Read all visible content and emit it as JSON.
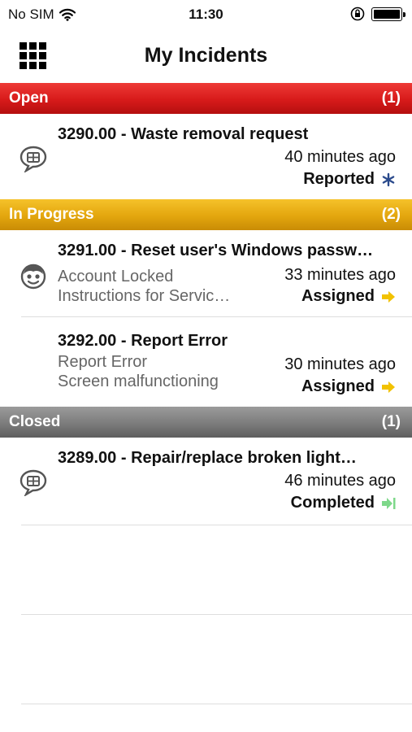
{
  "status_bar": {
    "carrier": "No SIM",
    "time": "11:30"
  },
  "nav": {
    "title": "My Incidents"
  },
  "sections": [
    {
      "label": "Open",
      "count": "(1)",
      "color": "#d71a1a",
      "items": [
        {
          "title": "3290.00 - Waste removal request",
          "line1": "",
          "line2": "",
          "time": "40 minutes ago",
          "status": "Reported",
          "icon": "speech-bubble-icon",
          "status_icon": "asterisk-icon"
        }
      ]
    },
    {
      "label": "In Progress",
      "count": "(2)",
      "color": "#e3a60e",
      "items": [
        {
          "title": "3291.00 - Reset user's Windows passw…",
          "line1": "Account Locked",
          "line2": "Instructions for Servic…",
          "time": "33 minutes ago",
          "status": "Assigned",
          "icon": "support-face-icon",
          "status_icon": "arrow-right-icon"
        },
        {
          "title": "3292.00 - Report Error",
          "line1": "Report Error",
          "line2": "Screen malfunctioning",
          "time": "30 minutes ago",
          "status": "Assigned",
          "icon": "",
          "status_icon": "arrow-right-icon"
        }
      ]
    },
    {
      "label": "Closed",
      "count": "(1)",
      "color": "#7c7c7c",
      "items": [
        {
          "title": "3289.00 - Repair/replace broken light…",
          "line1": "",
          "line2": "",
          "time": "46 minutes ago",
          "status": "Completed",
          "icon": "speech-bubble-icon",
          "status_icon": "arrow-right-end-icon"
        }
      ]
    }
  ],
  "colors": {
    "reported_icon": "#2a4a8c",
    "assigned_icon": "#f2c200",
    "completed_icon": "#7ed88a"
  }
}
